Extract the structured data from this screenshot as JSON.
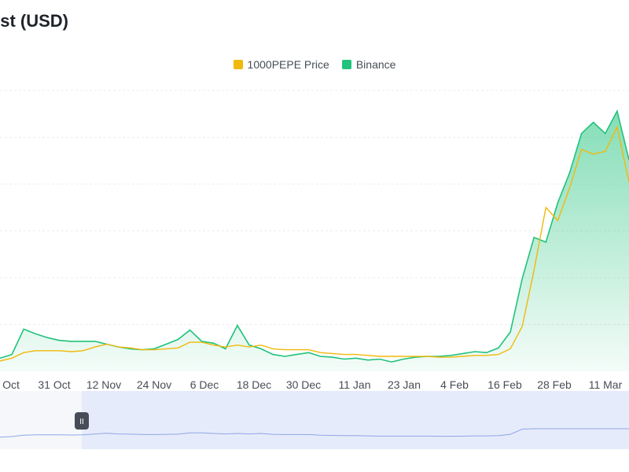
{
  "chart_data": {
    "type": "line",
    "title": "est (USD)",
    "legend_position": "top-center",
    "grid": true,
    "colors": {
      "1000PEPE Price": "#f0b90b",
      "Binance": "#20c27c"
    },
    "x_ticks": [
      "Oct",
      "31 Oct",
      "12 Nov",
      "24 Nov",
      "6 Dec",
      "18 Dec",
      "30 Dec",
      "11 Jan",
      "23 Jan",
      "4 Feb",
      "16 Feb",
      "28 Feb",
      "11 Mar"
    ],
    "x": [
      "Oct 19",
      "Oct 22",
      "Oct 25",
      "Oct 28",
      "Oct 31",
      "Nov 3",
      "Nov 6",
      "Nov 9",
      "Nov 12",
      "Nov 15",
      "Nov 18",
      "Nov 21",
      "Nov 24",
      "Nov 27",
      "Nov 30",
      "Dec 3",
      "Dec 6",
      "Dec 9",
      "Dec 12",
      "Dec 15",
      "Dec 18",
      "Dec 21",
      "Dec 24",
      "Dec 27",
      "Dec 30",
      "Jan 2",
      "Jan 5",
      "Jan 8",
      "Jan 11",
      "Jan 14",
      "Jan 17",
      "Jan 20",
      "Jan 23",
      "Jan 26",
      "Jan 29",
      "Feb 1",
      "Feb 4",
      "Feb 7",
      "Feb 10",
      "Feb 13",
      "Feb 16",
      "Feb 19",
      "Feb 22",
      "Feb 25",
      "Feb 27",
      "Feb 29",
      "Mar 2",
      "Mar 4",
      "Mar 6",
      "Mar 8",
      "Mar 10",
      "Mar 12",
      "Mar 14",
      "Mar 15"
    ],
    "series": [
      {
        "name": "Binance",
        "values": [
          0.4,
          0.8,
          3.5,
          3.0,
          2.6,
          2.3,
          2.2,
          2.2,
          2.2,
          1.9,
          1.6,
          1.4,
          1.3,
          1.4,
          1.9,
          2.4,
          3.4,
          2.2,
          2.0,
          1.4,
          3.9,
          1.8,
          1.4,
          0.8,
          0.6,
          0.8,
          1.0,
          0.6,
          0.5,
          0.3,
          0.4,
          0.2,
          0.3,
          0.0,
          0.3,
          0.5,
          0.6,
          0.6,
          0.7,
          0.9,
          1.1,
          1.0,
          1.5,
          3.2,
          8.9,
          13.3,
          12.8,
          17.0,
          20.2,
          24.4,
          25.6,
          24.4,
          26.8,
          21.6
        ]
      },
      {
        "name": "1000PEPE Price",
        "values": [
          0.1,
          0.4,
          1.0,
          1.2,
          1.2,
          1.2,
          1.1,
          1.2,
          1.6,
          1.9,
          1.6,
          1.5,
          1.3,
          1.3,
          1.4,
          1.5,
          2.1,
          2.1,
          1.8,
          1.6,
          1.8,
          1.6,
          1.8,
          1.4,
          1.3,
          1.3,
          1.3,
          1.0,
          0.9,
          0.8,
          0.8,
          0.7,
          0.6,
          0.6,
          0.6,
          0.6,
          0.6,
          0.5,
          0.5,
          0.6,
          0.7,
          0.7,
          0.8,
          1.4,
          3.8,
          9.8,
          16.5,
          15.1,
          18.6,
          22.7,
          22.2,
          22.5,
          25.1,
          19.2
        ]
      }
    ],
    "ylim": [
      -1,
      29
    ],
    "navigator": {
      "handle_glyph": "II",
      "selection_start_fraction": 0.13,
      "selection_end_fraction": 1.0
    }
  }
}
